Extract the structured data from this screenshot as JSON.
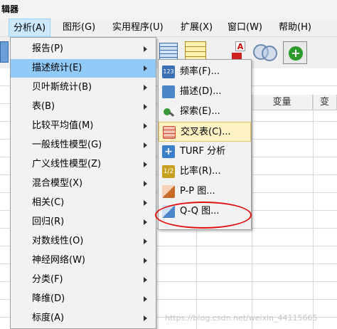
{
  "window": {
    "title": "辑器"
  },
  "menubar": {
    "items": [
      {
        "label": "分析(A)",
        "active": true
      },
      {
        "label": "图形(G)"
      },
      {
        "label": "实用程序(U)"
      },
      {
        "label": "扩展(X)"
      },
      {
        "label": "窗口(W)"
      },
      {
        "label": "帮助(H)"
      }
    ]
  },
  "grid": {
    "columns": [
      "变量",
      "变"
    ]
  },
  "analyze_menu": {
    "items": [
      {
        "label": "报告(P)"
      },
      {
        "label": "描述统计(E)",
        "active": true
      },
      {
        "label": "贝叶斯统计(B)"
      },
      {
        "label": "表(B)"
      },
      {
        "label": "比较平均值(M)"
      },
      {
        "label": "一般线性模型(G)"
      },
      {
        "label": "广义线性模型(Z)"
      },
      {
        "label": "混合模型(X)"
      },
      {
        "label": "相关(C)"
      },
      {
        "label": "回归(R)"
      },
      {
        "label": "对数线性(O)"
      },
      {
        "label": "神经网络(W)"
      },
      {
        "label": "分类(F)"
      },
      {
        "label": "降维(D)"
      },
      {
        "label": "标度(A)"
      }
    ]
  },
  "descriptive_menu": {
    "items": [
      {
        "label": "频率(F)...",
        "icon": "frequencies-icon",
        "color": "#3b6fb6"
      },
      {
        "label": "描述(D)...",
        "icon": "descriptives-icon",
        "color": "#4a86c8"
      },
      {
        "label": "探索(E)...",
        "icon": "explore-icon",
        "color": "#3a9a3a"
      },
      {
        "label": "交叉表(C)...",
        "icon": "crosstabs-icon",
        "color": "#d04a2a",
        "active": true
      },
      {
        "label": "TURF 分析",
        "icon": "turf-icon",
        "color": "#3b7fc8"
      },
      {
        "label": "比率(R)...",
        "icon": "ratio-icon",
        "color": "#c8a020"
      },
      {
        "label": "P-P 图...",
        "icon": "pp-plot-icon",
        "color": "#c86a2a"
      },
      {
        "label": "Q-Q 图...",
        "icon": "qq-plot-icon",
        "color": "#4a86c8",
        "highlighted": true
      }
    ]
  },
  "watermark": "https://blog.csdn.net/weixin_44115665",
  "colors": {
    "menu_active": "#91c9f7",
    "submenu_active": "#fef3c5",
    "annotation": "#e01010"
  }
}
